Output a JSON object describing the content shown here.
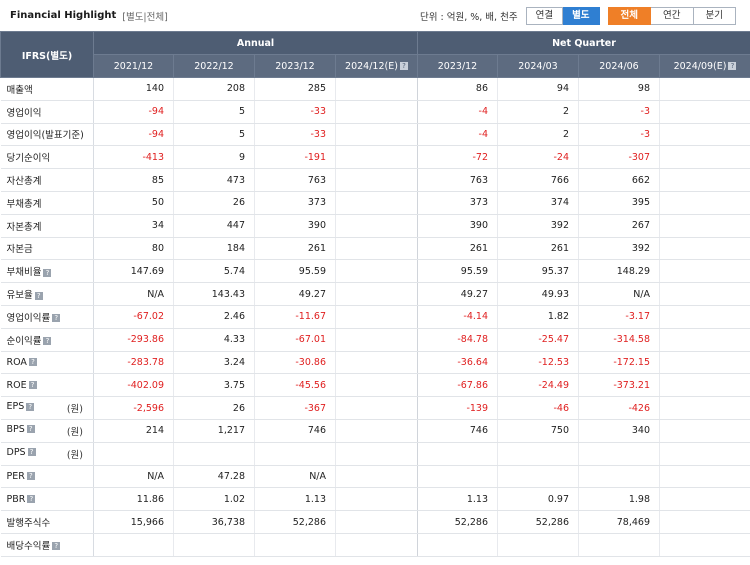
{
  "header": {
    "title": "Financial Highlight",
    "subtitle": "[별도|전체]",
    "unit": "단위 : 억원, %, 배, 천주",
    "scope_toggle": {
      "options": [
        "연결",
        "별도"
      ],
      "selected": "별도"
    },
    "period_toggle": {
      "options": [
        "전체",
        "연간",
        "분기"
      ],
      "selected": "전체"
    }
  },
  "table": {
    "corner_label": "IFRS(별도)",
    "group_annual": "Annual",
    "group_quarter": "Net Quarter",
    "annual_cols": [
      "2021/12",
      "2022/12",
      "2023/12",
      "2024/12(E)"
    ],
    "quarter_cols": [
      "2023/12",
      "2024/03",
      "2024/06",
      "2024/09(E)"
    ],
    "rows": [
      {
        "label": "매출액",
        "unit": "",
        "help": false,
        "annual": [
          "140",
          "208",
          "285",
          ""
        ],
        "quarter": [
          "86",
          "94",
          "98",
          ""
        ]
      },
      {
        "label": "영업이익",
        "unit": "",
        "help": false,
        "annual": [
          "-94",
          "5",
          "-33",
          ""
        ],
        "quarter": [
          "-4",
          "2",
          "-3",
          ""
        ]
      },
      {
        "label": "영업이익(발표기준)",
        "unit": "",
        "help": false,
        "annual": [
          "-94",
          "5",
          "-33",
          ""
        ],
        "quarter": [
          "-4",
          "2",
          "-3",
          ""
        ]
      },
      {
        "label": "당기순이익",
        "unit": "",
        "help": false,
        "annual": [
          "-413",
          "9",
          "-191",
          ""
        ],
        "quarter": [
          "-72",
          "-24",
          "-307",
          ""
        ]
      },
      {
        "label": "자산총계",
        "unit": "",
        "help": false,
        "annual": [
          "85",
          "473",
          "763",
          ""
        ],
        "quarter": [
          "763",
          "766",
          "662",
          ""
        ]
      },
      {
        "label": "부채총계",
        "unit": "",
        "help": false,
        "annual": [
          "50",
          "26",
          "373",
          ""
        ],
        "quarter": [
          "373",
          "374",
          "395",
          ""
        ]
      },
      {
        "label": "자본총계",
        "unit": "",
        "help": false,
        "annual": [
          "34",
          "447",
          "390",
          ""
        ],
        "quarter": [
          "390",
          "392",
          "267",
          ""
        ]
      },
      {
        "label": "자본금",
        "unit": "",
        "help": false,
        "annual": [
          "80",
          "184",
          "261",
          ""
        ],
        "quarter": [
          "261",
          "261",
          "392",
          ""
        ]
      },
      {
        "label": "부채비율",
        "unit": "",
        "help": true,
        "annual": [
          "147.69",
          "5.74",
          "95.59",
          ""
        ],
        "quarter": [
          "95.59",
          "95.37",
          "148.29",
          ""
        ]
      },
      {
        "label": "유보율",
        "unit": "",
        "help": true,
        "annual": [
          "N/A",
          "143.43",
          "49.27",
          ""
        ],
        "quarter": [
          "49.27",
          "49.93",
          "N/A",
          ""
        ]
      },
      {
        "label": "영업이익률",
        "unit": "",
        "help": true,
        "annual": [
          "-67.02",
          "2.46",
          "-11.67",
          ""
        ],
        "quarter": [
          "-4.14",
          "1.82",
          "-3.17",
          ""
        ]
      },
      {
        "label": "순이익률",
        "unit": "",
        "help": true,
        "annual": [
          "-293.86",
          "4.33",
          "-67.01",
          ""
        ],
        "quarter": [
          "-84.78",
          "-25.47",
          "-314.58",
          ""
        ]
      },
      {
        "label": "ROA",
        "unit": "",
        "help": true,
        "annual": [
          "-283.78",
          "3.24",
          "-30.86",
          ""
        ],
        "quarter": [
          "-36.64",
          "-12.53",
          "-172.15",
          ""
        ]
      },
      {
        "label": "ROE",
        "unit": "",
        "help": true,
        "annual": [
          "-402.09",
          "3.75",
          "-45.56",
          ""
        ],
        "quarter": [
          "-67.86",
          "-24.49",
          "-373.21",
          ""
        ]
      },
      {
        "label": "EPS",
        "unit": "(원)",
        "help": true,
        "annual": [
          "-2,596",
          "26",
          "-367",
          ""
        ],
        "quarter": [
          "-139",
          "-46",
          "-426",
          ""
        ]
      },
      {
        "label": "BPS",
        "unit": "(원)",
        "help": true,
        "annual": [
          "214",
          "1,217",
          "746",
          ""
        ],
        "quarter": [
          "746",
          "750",
          "340",
          ""
        ]
      },
      {
        "label": "DPS",
        "unit": "(원)",
        "help": true,
        "annual": [
          "",
          "",
          "",
          ""
        ],
        "quarter": [
          "",
          "",
          "",
          ""
        ]
      },
      {
        "label": "PER",
        "unit": "",
        "help": true,
        "annual": [
          "N/A",
          "47.28",
          "N/A",
          ""
        ],
        "quarter": [
          "",
          "",
          "",
          ""
        ]
      },
      {
        "label": "PBR",
        "unit": "",
        "help": true,
        "annual": [
          "11.86",
          "1.02",
          "1.13",
          ""
        ],
        "quarter": [
          "1.13",
          "0.97",
          "1.98",
          ""
        ]
      },
      {
        "label": "발행주식수",
        "unit": "",
        "help": false,
        "annual": [
          "15,966",
          "36,738",
          "52,286",
          ""
        ],
        "quarter": [
          "52,286",
          "52,286",
          "78,469",
          ""
        ]
      },
      {
        "label": "배당수익률",
        "unit": "",
        "help": true,
        "annual": [
          "",
          "",
          "",
          ""
        ],
        "quarter": [
          "",
          "",
          "",
          ""
        ]
      }
    ]
  },
  "colors": {
    "header_bg": "#4e5d73",
    "negative": "#e02020",
    "toggle_blue": "#2f7fd2",
    "toggle_orange": "#ef7f27"
  }
}
